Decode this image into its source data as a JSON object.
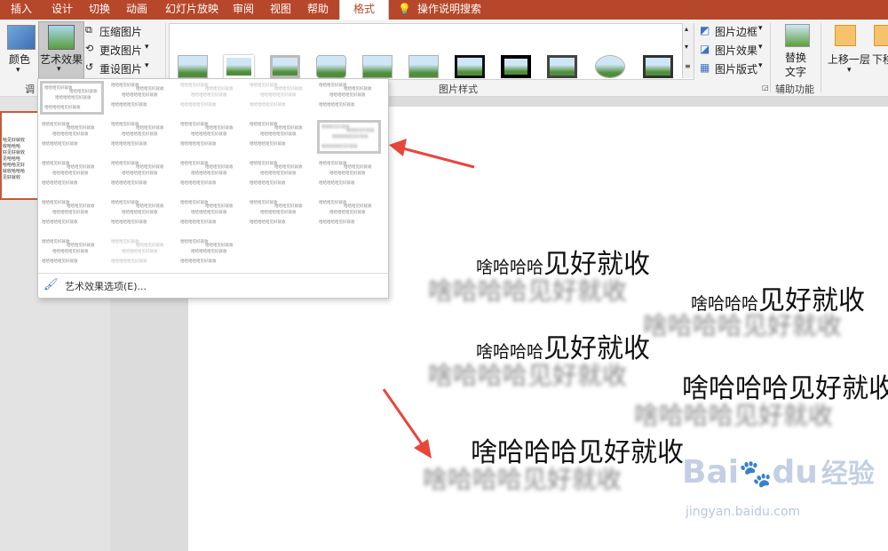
{
  "tabs": [
    "插入",
    "设计",
    "切换",
    "动画",
    "幻灯片放映",
    "审阅",
    "视图",
    "帮助",
    "格式"
  ],
  "active_tab": "格式",
  "tell_me": "操作说明搜索",
  "adjust": {
    "color": "颜色",
    "artistic": "艺术效果",
    "group_label": "调"
  },
  "pic_buttons": {
    "compress": "压缩图片",
    "change": "更改图片",
    "reset": "重设图片"
  },
  "pic_style": {
    "border": "图片边框",
    "effects": "图片效果",
    "layout": "图片版式",
    "group_label": "图片样式"
  },
  "alt_text": {
    "label_line1": "替换",
    "label_line2": "文字",
    "group_label": "辅助功能"
  },
  "arrange": {
    "bring_forward": "上移一层",
    "send_backward": "下移"
  },
  "gallery": {
    "line1": "哈哈哈见好就收",
    "line2": "哈哈哈哈哈见好就收",
    "footer": "艺术效果选项(E)..."
  },
  "slide_texts": [
    {
      "prefix": "啥哈哈哈",
      "main": "见好就收"
    },
    {
      "prefix": "啥哈哈哈",
      "main": "见好就收"
    },
    {
      "prefix": "啥哈哈哈",
      "main": "见好就收"
    },
    {
      "prefix": "",
      "main": "啥哈哈哈见好就收"
    },
    {
      "prefix": "",
      "main": "啥哈哈哈见好就收"
    }
  ],
  "blur_texts": [
    "啥哈哈哈见好就收",
    "啥哈哈哈见好就收",
    "啥哈哈哈见好就收",
    "啥哈哈哈见好就收",
    "啥哈哈哈见好就收"
  ],
  "thumb_text": [
    "哈见好就收",
    "收哈哈哈",
    "好见好就收",
    "见哈哈哈",
    "哈哈哈见好",
    "就收哈哈哈",
    "见好就收"
  ],
  "watermark": {
    "brand": "Bai",
    "brand2": "du",
    "cn": "经验",
    "url": "jingyan.baidu.com"
  },
  "colors": {
    "accent": "#b7472a",
    "arrow": "#e8453c"
  }
}
